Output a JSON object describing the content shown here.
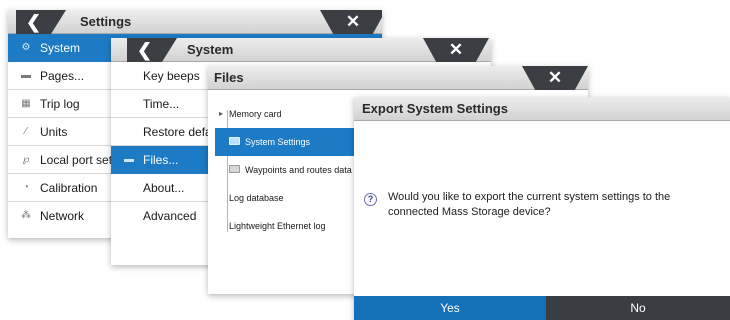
{
  "settings": {
    "title": "Settings",
    "back_glyph": "❮",
    "close_glyph": "✕",
    "items": [
      {
        "label": "System",
        "icon": "gear-icon",
        "glyph": "⚙",
        "selected": true
      },
      {
        "label": "Pages...",
        "icon": "pages-icon",
        "glyph": "▬"
      },
      {
        "label": "Trip log",
        "icon": "trip-log-icon",
        "glyph": "▦"
      },
      {
        "label": "Units",
        "icon": "ruler-icon",
        "glyph": "∕"
      },
      {
        "label": "Local port set",
        "icon": "port-icon",
        "glyph": "℘"
      },
      {
        "label": "Calibration",
        "icon": "calibration-icon",
        "glyph": "◔"
      },
      {
        "label": "Network",
        "icon": "network-icon",
        "glyph": "⁂"
      }
    ]
  },
  "system": {
    "title": "System",
    "back_glyph": "❮",
    "close_glyph": "✕",
    "items": [
      {
        "label": "Key beeps"
      },
      {
        "label": "Time..."
      },
      {
        "label": "Restore defa"
      },
      {
        "label": "Files...",
        "selected": true,
        "icon": "folder-icon",
        "glyph": "▬"
      },
      {
        "label": "About..."
      },
      {
        "label": "Advanced"
      }
    ]
  },
  "files": {
    "title": "Files",
    "close_glyph": "✕",
    "tree": [
      {
        "label": "Memory card",
        "expander": "▸"
      },
      {
        "label": "System Settings",
        "selected": true,
        "icon": "file-icon"
      },
      {
        "label": "Waypoints and routes data",
        "icon": "file-icon"
      },
      {
        "label": "Log database"
      },
      {
        "label": "Lightweight Ethernet log"
      }
    ]
  },
  "dialog": {
    "title": "Export System Settings",
    "question_icon": "?",
    "message": "Would you like to export the current system settings to the connected Mass Storage device?",
    "yes_label": "Yes",
    "no_label": "No"
  },
  "colors": {
    "accent": "#1d7bc5",
    "titlebar_dark": "#3b3f44",
    "yes_button": "#1471b8",
    "no_button": "#3a3d41"
  }
}
